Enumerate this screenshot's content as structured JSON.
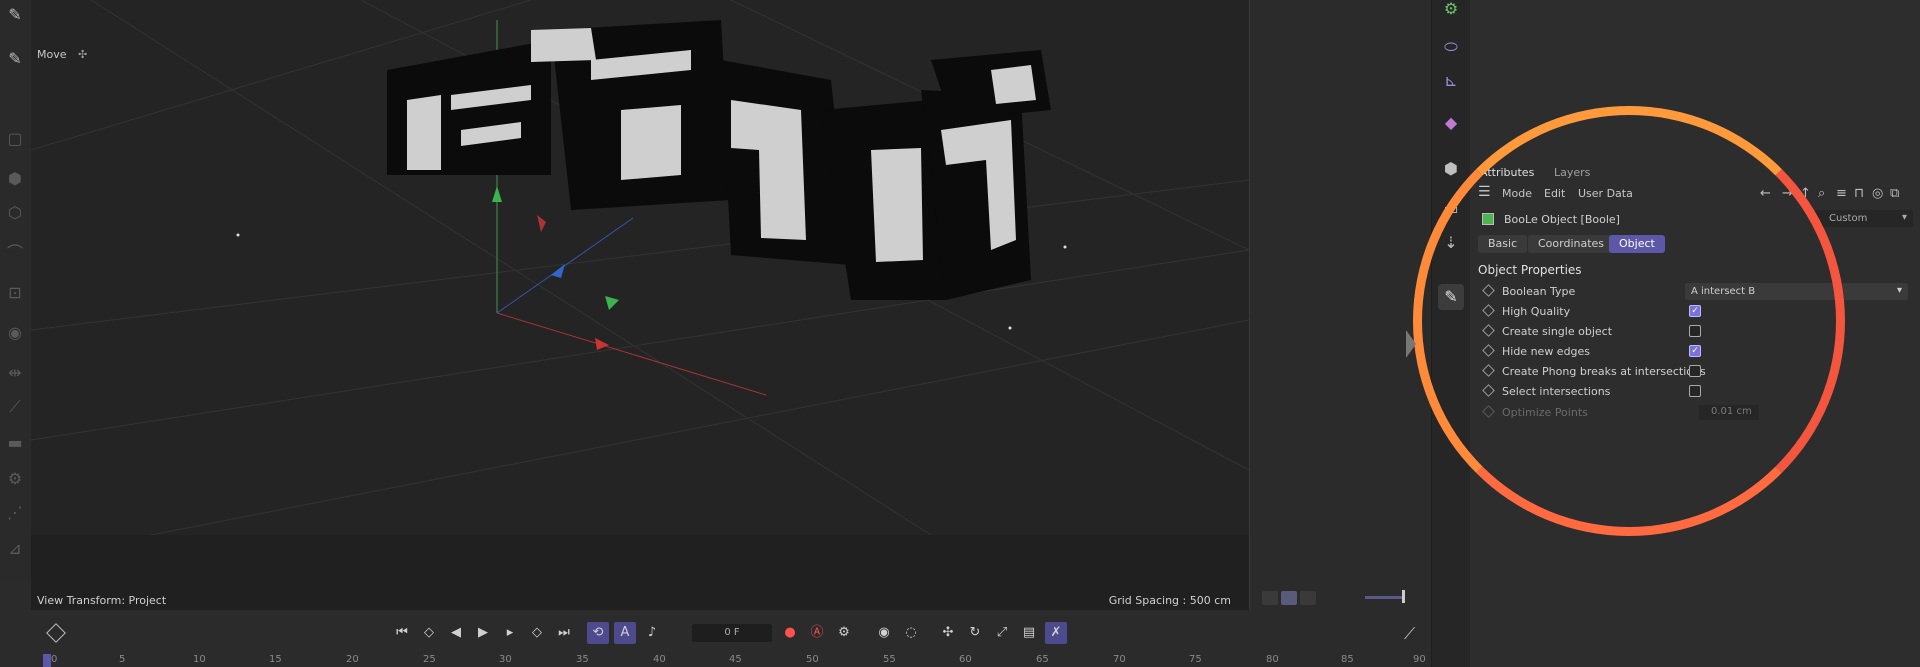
{
  "viewport": {
    "mode_label": "Move",
    "view_transform": "View Transform: Project",
    "grid_spacing": "Grid Spacing : 500 cm"
  },
  "attributes": {
    "tabs": [
      "Attributes",
      "Layers"
    ],
    "menu": [
      "Mode",
      "Edit",
      "User Data"
    ],
    "object_title": "BooLe Object [Boole]",
    "custom_label": "Custom",
    "property_tabs": [
      "Basic",
      "Coordinates",
      "Object"
    ],
    "active_tab": "Object",
    "section_title": "Object Properties",
    "boolean_type_label": "Boolean Type",
    "boolean_type_value": "A intersect B",
    "properties": [
      {
        "label": "High Quality",
        "checked": true
      },
      {
        "label": "Create single object",
        "checked": false
      },
      {
        "label": "Hide new edges",
        "checked": true
      },
      {
        "label": "Create Phong breaks at intersections",
        "checked": false
      },
      {
        "label": "Select intersections",
        "checked": false
      }
    ],
    "optimize_points_label": "Optimize Points",
    "optimize_points_value": "0.01 cm"
  },
  "timeline": {
    "current_frame": "0 F",
    "ticks": [
      "0",
      "5",
      "10",
      "15",
      "20",
      "25",
      "30",
      "35",
      "40",
      "45",
      "50",
      "55",
      "60",
      "65",
      "70",
      "75",
      "80",
      "85",
      "90"
    ]
  },
  "colors": {
    "accent": "#5c57a8",
    "highlight": "#ff7a45"
  }
}
